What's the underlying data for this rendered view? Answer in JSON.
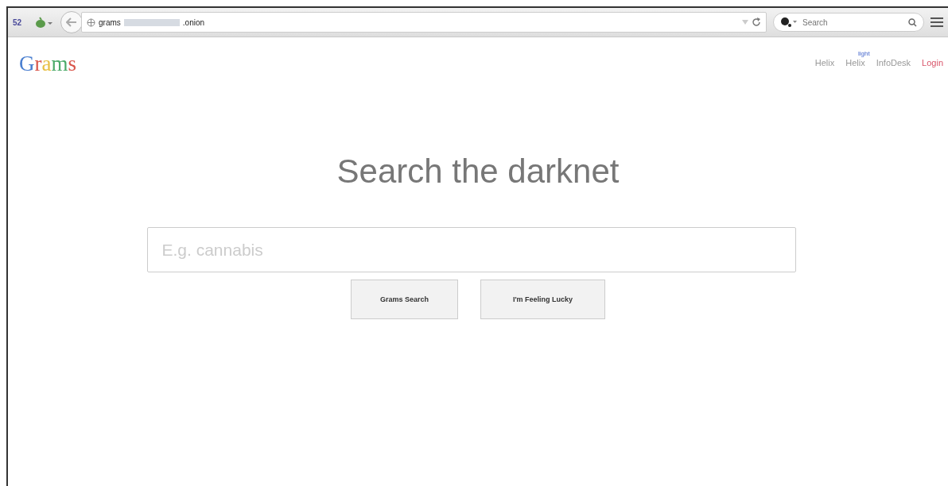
{
  "toolbar": {
    "badge": "52",
    "url_start": "grams",
    "url_end": ".onion",
    "search": {
      "placeholder": "Search"
    }
  },
  "logo": [
    {
      "letter": "G",
      "color": "#4a7fd0"
    },
    {
      "letter": "r",
      "color": "#d9554a"
    },
    {
      "letter": "a",
      "color": "#e8c046"
    },
    {
      "letter": "m",
      "color": "#4caa6a"
    },
    {
      "letter": "s",
      "color": "#d9554a"
    }
  ],
  "nav": [
    {
      "label": "Helix",
      "kind": "link"
    },
    {
      "label": "Helix",
      "note": "light",
      "kind": "link"
    },
    {
      "label": "InfoDesk",
      "kind": "link"
    },
    {
      "label": "Login",
      "kind": "login"
    }
  ],
  "heading": "Search the darknet",
  "query": {
    "placeholder": "E.g. cannabis"
  },
  "buttons": [
    "Grams Search",
    "I'm Feeling Lucky"
  ]
}
